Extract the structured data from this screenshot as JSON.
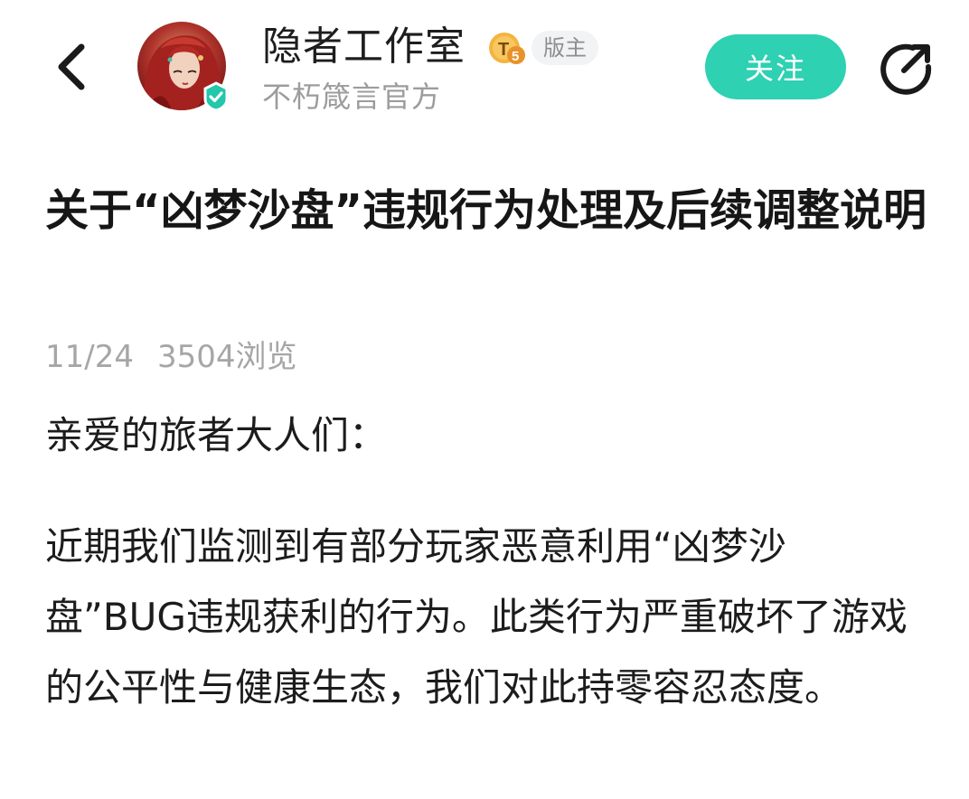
{
  "header": {
    "author_name": "隐者工作室",
    "level_badge": "T5",
    "role_badge": "版主",
    "author_subtitle": "不朽箴言官方",
    "follow_label": "关注",
    "accent_color": "#2ed1b2"
  },
  "icons": {
    "back": "chevron-left-icon",
    "share": "share-icon",
    "verified": "verified-check-icon"
  },
  "article": {
    "title": "关于“凶梦沙盘”违规行为处理及后续调整说明",
    "date": "11/24",
    "views": "3504浏览",
    "greeting": "亲爱的旅者大人们：",
    "paragraph": "近期我们监测到有部分玩家恶意利用“凶梦沙盘”BUG违规获利的行为。此类行为严重破坏了游戏的公平性与健康生态，我们对此持零容忍态度。"
  }
}
